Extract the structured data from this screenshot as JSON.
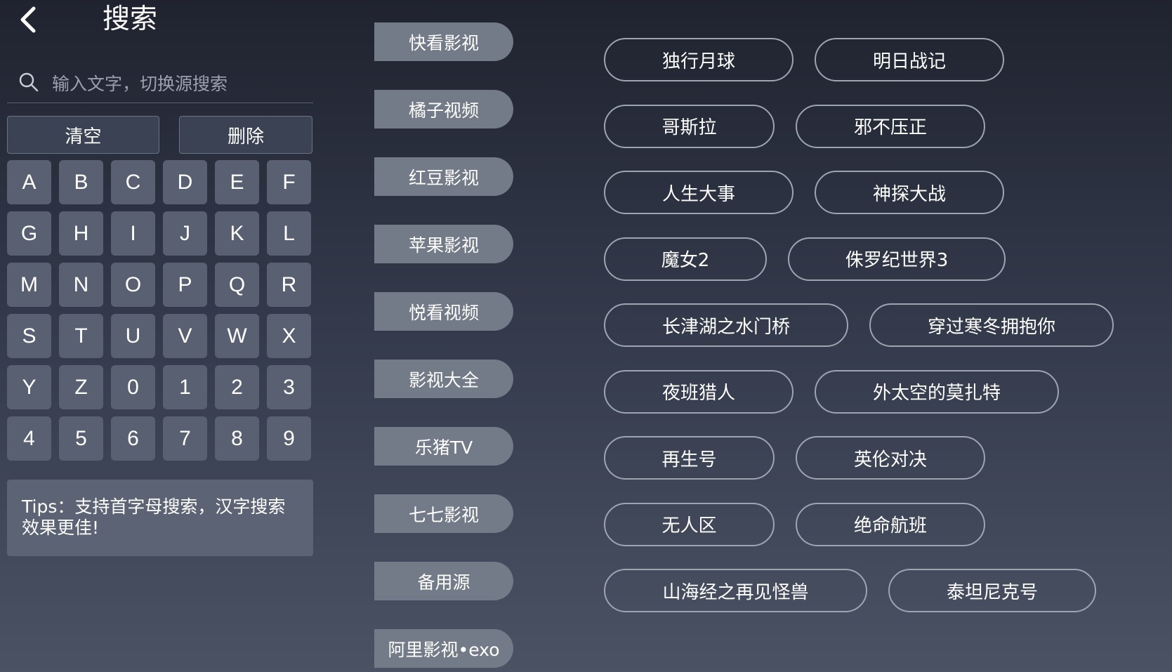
{
  "header": {
    "title": "搜索"
  },
  "search": {
    "placeholder": "输入文字，切换源搜索",
    "value": ""
  },
  "actions": {
    "clear_label": "清空",
    "delete_label": "删除"
  },
  "keyboard": [
    "A",
    "B",
    "C",
    "D",
    "E",
    "F",
    "G",
    "H",
    "I",
    "J",
    "K",
    "L",
    "M",
    "N",
    "O",
    "P",
    "Q",
    "R",
    "S",
    "T",
    "U",
    "V",
    "W",
    "X",
    "Y",
    "Z",
    "0",
    "1",
    "2",
    "3",
    "4",
    "5",
    "6",
    "7",
    "8",
    "9"
  ],
  "tips": "Tips：支持首字母搜索，汉字搜索效果更佳!",
  "sources": [
    "快看影视",
    "橘子视频",
    "红豆影视",
    "苹果影视",
    "悦看视频",
    "影视大全",
    "乐猪TV",
    "七七影视",
    "备用源",
    "阿里影视•exo"
  ],
  "hot_words": [
    [
      "独行月球",
      "明日战记"
    ],
    [
      "哥斯拉",
      "邪不压正"
    ],
    [
      "人生大事",
      "神探大战"
    ],
    [
      "魔女2",
      "侏罗纪世界3"
    ],
    [
      "长津湖之水门桥",
      "穿过寒冬拥抱你"
    ],
    [
      "夜班猎人",
      "外太空的莫扎特"
    ],
    [
      "再生号",
      "英伦对决"
    ],
    [
      "无人区",
      "绝命航班"
    ],
    [
      "山海经之再见怪兽",
      "泰坦尼克号"
    ]
  ]
}
